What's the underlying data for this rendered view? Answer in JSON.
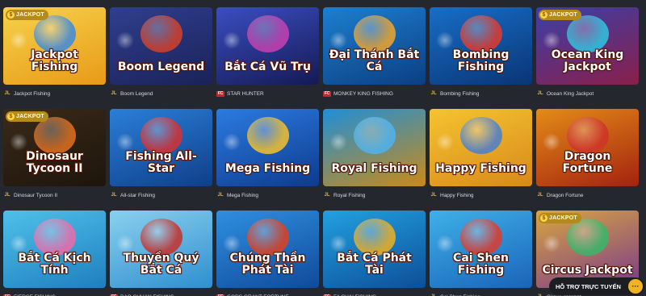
{
  "badge": {
    "jackpot": "JACKPOT",
    "coin": "$"
  },
  "support": {
    "label": "HỖ TRỢ TRỰC TUYẾN",
    "icon": "chat-bubble-icon",
    "dots": "···"
  },
  "providers": {
    "jl": "JL",
    "fc": "FC"
  },
  "games": [
    {
      "name": "Jackpot Fishing",
      "logo": "Jackpot Fishing",
      "provider": "jl",
      "jackpot": true,
      "bg": [
        "#f7d24a",
        "#e89a18"
      ],
      "accent": "#3b8be0"
    },
    {
      "name": "Boom Legend",
      "logo": "Boom Legend",
      "provider": "jl",
      "jackpot": false,
      "bg": [
        "#2f3f8f",
        "#1b2258"
      ],
      "accent": "#d5402b"
    },
    {
      "name": "STAR HUNTER",
      "logo": "Bắt Cá Vũ Trụ",
      "provider": "fc",
      "jackpot": false,
      "bg": [
        "#3a4ec0",
        "#151a55"
      ],
      "accent": "#c83fb0"
    },
    {
      "name": "MONKEY KING FISHING",
      "logo": "Đại Thánh Bắt Cá",
      "provider": "fc",
      "jackpot": false,
      "bg": [
        "#1d7fd0",
        "#0b3f82"
      ],
      "accent": "#f1a52a"
    },
    {
      "name": "Bombing Fishing",
      "logo": "Bombing Fishing",
      "provider": "jl",
      "jackpot": false,
      "bg": [
        "#176ec7",
        "#0a3575"
      ],
      "accent": "#e33a2c"
    },
    {
      "name": "Ocean King Jackpot",
      "logo": "Ocean King Jackpot",
      "provider": "jl",
      "jackpot": true,
      "bg": [
        "#3a3fa8",
        "#8a1f4a"
      ],
      "accent": "#2dc6e0"
    },
    {
      "name": "Dinosaur Tycoon II",
      "logo": "Dinosaur Tycoon II",
      "provider": "jl",
      "jackpot": true,
      "bg": [
        "#3a2a1a",
        "#1e150c"
      ],
      "accent": "#e0701f"
    },
    {
      "name": "All-star Fishing",
      "logo": "Fishing All-Star",
      "provider": "jl",
      "jackpot": false,
      "bg": [
        "#2a7fd8",
        "#0f3f8a"
      ],
      "accent": "#d83030"
    },
    {
      "name": "Mega Fishing",
      "logo": "Mega Fishing",
      "provider": "jl",
      "jackpot": false,
      "bg": [
        "#2b7be0",
        "#0e3b8f"
      ],
      "accent": "#f5c22a"
    },
    {
      "name": "Royal Fishing",
      "logo": "Royal Fishing",
      "provider": "jl",
      "jackpot": false,
      "bg": [
        "#1f8fd8",
        "#c98a17"
      ],
      "accent": "#4fb3f0"
    },
    {
      "name": "Happy Fishing",
      "logo": "Happy Fishing",
      "provider": "jl",
      "jackpot": false,
      "bg": [
        "#f4c430",
        "#d8891a"
      ],
      "accent": "#4a7fd0"
    },
    {
      "name": "Dragon Fortune",
      "logo": "Dragon Fortune",
      "provider": "jl",
      "jackpot": false,
      "bg": [
        "#e38b18",
        "#a4220f"
      ],
      "accent": "#d0332a"
    },
    {
      "name": "FIERCE FISHING",
      "logo": "Bắt Cá Kịch Tính",
      "provider": "fc",
      "jackpot": false,
      "bg": [
        "#4fc0e8",
        "#1f7fc0"
      ],
      "accent": "#f06aa8"
    },
    {
      "name": "BAO CHUAN FISHING",
      "logo": "Thuyền Quý Bắt Cá",
      "provider": "fc",
      "jackpot": false,
      "bg": [
        "#8ad0ee",
        "#2f8fcf"
      ],
      "accent": "#c6302a"
    },
    {
      "name": "GODS GRANT FORTUNE",
      "logo": "Chúng Thần Phát Tài",
      "provider": "fc",
      "jackpot": false,
      "bg": [
        "#2f8fe0",
        "#104a9a"
      ],
      "accent": "#e0401f"
    },
    {
      "name": "FA CHAI FISHING",
      "logo": "Bắt Cá Phát Tài",
      "provider": "fc",
      "jackpot": false,
      "bg": [
        "#22a0e0",
        "#0d4f98"
      ],
      "accent": "#f0b020"
    },
    {
      "name": "Cai Shen Fishing",
      "logo": "Cai Shen Fishing",
      "provider": "jl",
      "jackpot": false,
      "bg": [
        "#3fb0e8",
        "#1a64b8"
      ],
      "accent": "#e03a2a"
    },
    {
      "name": "Circus Jackpot",
      "logo": "Circus Jackpot",
      "provider": "jl",
      "jackpot": true,
      "bg": [
        "#d8a640",
        "#7a3a8a"
      ],
      "accent": "#35b86a"
    }
  ]
}
